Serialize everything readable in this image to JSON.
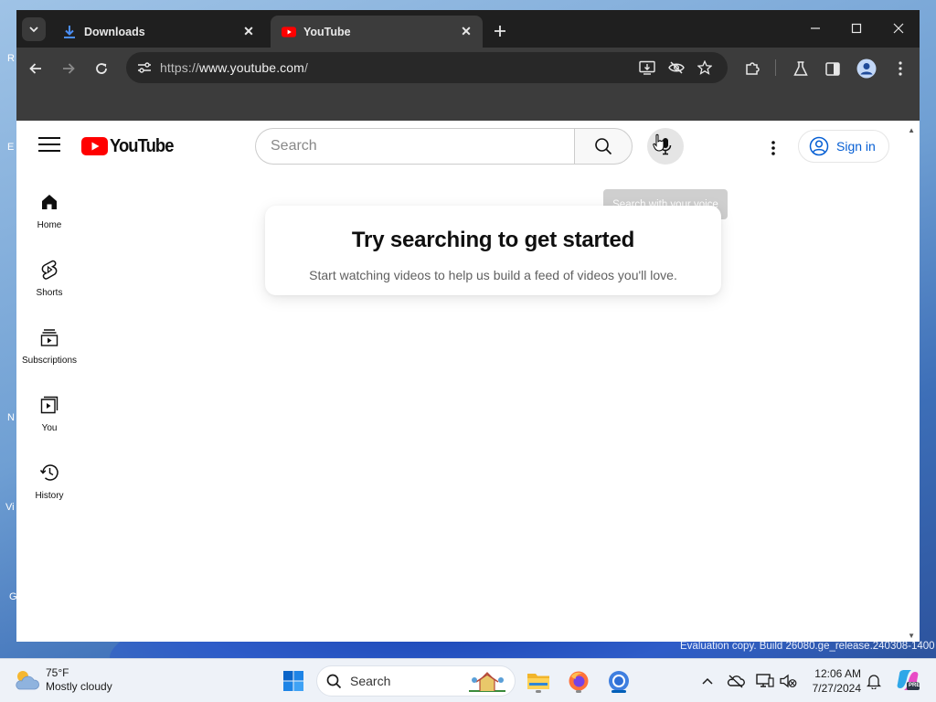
{
  "browser": {
    "tabs": [
      {
        "label": "Downloads",
        "icon": "download-icon",
        "active": false
      },
      {
        "label": "YouTube",
        "icon": "youtube-icon",
        "active": true
      }
    ],
    "url_scheme": "https://",
    "url_host": "www.youtube.com",
    "url_path": "/"
  },
  "youtube": {
    "logo_text": "YouTube",
    "search_placeholder": "Search",
    "voice_tooltip": "Search with your voice",
    "sign_in": "Sign in",
    "nav": [
      {
        "label": "Home",
        "icon": "home-icon"
      },
      {
        "label": "Shorts",
        "icon": "shorts-icon"
      },
      {
        "label": "Subscriptions",
        "icon": "subscriptions-icon"
      },
      {
        "label": "You",
        "icon": "you-icon"
      },
      {
        "label": "History",
        "icon": "history-icon"
      }
    ],
    "prompt_title": "Try searching to get started",
    "prompt_subtitle": "Start watching videos to help us build a feed of videos you'll love."
  },
  "desktop": {
    "watermark": "Evaluation copy. Build 26080.ge_release.240308-1400"
  },
  "taskbar": {
    "weather_temp": "75°F",
    "weather_desc": "Mostly cloudy",
    "search_label": "Search",
    "time": "12:06 AM",
    "date": "7/27/2024"
  },
  "colors": {
    "brand_red": "#ff0000",
    "link_blue": "#065fd4",
    "chrome_dark": "#1f1f1f",
    "chrome_toolbar": "#3c3c3c"
  }
}
